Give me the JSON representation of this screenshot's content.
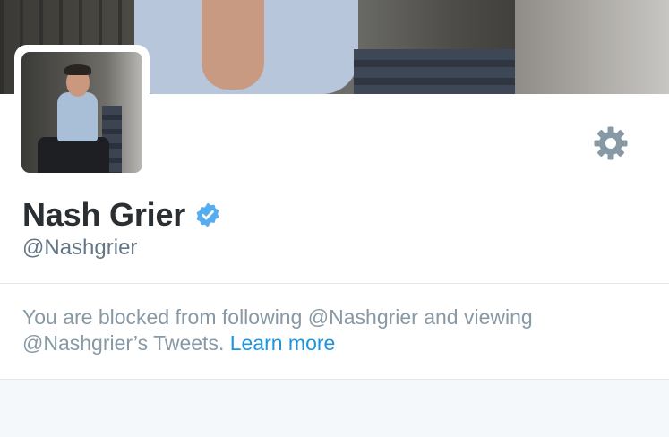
{
  "profile": {
    "name": "Nash Grier",
    "handle": "@Nashgrier",
    "verified": true
  },
  "notice": {
    "line1": "You are blocked from following @Nashgrier and viewing",
    "line2": "@Nashgrier’s Tweets.",
    "link_text": "Learn more"
  },
  "icons": {
    "settings": "gear-icon",
    "verified": "verified-badge-icon"
  },
  "colors": {
    "text_primary": "#292f33",
    "text_secondary": "#657786",
    "text_muted": "#8899a6",
    "link": "#1b95e0",
    "verified_badge": "#55acee",
    "gear": "#8899a6",
    "background": "#f5f8fa"
  }
}
